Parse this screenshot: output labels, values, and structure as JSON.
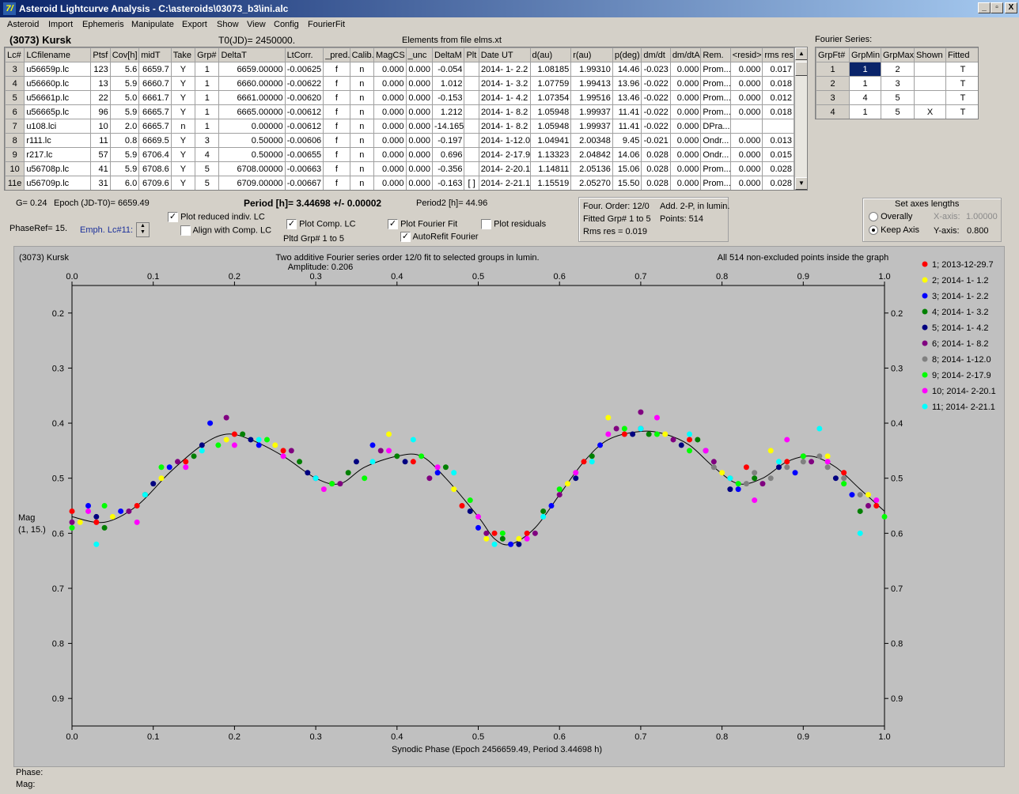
{
  "window": {
    "title": "Asteroid Lightcurve Analysis - C:\\asteroids\\03073_b3\\ini.alc",
    "icon": "7/",
    "controls": [
      "_",
      "▫",
      "X"
    ]
  },
  "menu": [
    "Asteroid",
    "Import",
    "Ephemeris",
    "Manipulate",
    "Export",
    "Show",
    "View",
    "Config",
    "FourierFit"
  ],
  "header": {
    "asteroid": "(3073) Kursk",
    "t0": "T0(JD)= 2450000.",
    "elements": "Elements from file elms.xt",
    "fourier_series": "Fourier Series:"
  },
  "lc_table": {
    "headers": [
      "Lc#",
      "LCfilename",
      "Ptsf",
      "Cov[h]",
      "midT",
      "Take",
      "Grp#",
      "DeltaT",
      "LtCorr.",
      "_pred.",
      "Calib.",
      "MagCS",
      "_unc",
      "DeltaM",
      "Plt",
      "Date UT",
      "d(au)",
      "r(au)",
      "p(deg)",
      "dm/dt",
      "dm/dtA",
      "Rem.",
      "<resid>",
      "rms res"
    ],
    "rows": [
      [
        "3",
        "u56659p.lc",
        "123",
        "5.6",
        "6659.7",
        "Y",
        "1",
        "6659.00000",
        "-0.00625",
        "f",
        "n",
        "0.000",
        "0.000",
        "-0.054",
        "",
        "2014- 1- 2.2",
        "1.08185",
        "1.99310",
        "14.46",
        "-0.023",
        "0.000",
        "Prom...",
        "0.000",
        "0.017"
      ],
      [
        "4",
        "u56660p.lc",
        "13",
        "5.9",
        "6660.7",
        "Y",
        "1",
        "6660.00000",
        "-0.00622",
        "f",
        "n",
        "0.000",
        "0.000",
        "1.012",
        "",
        "2014- 1- 3.2",
        "1.07759",
        "1.99413",
        "13.96",
        "-0.022",
        "0.000",
        "Prom...",
        "0.000",
        "0.018"
      ],
      [
        "5",
        "u56661p.lc",
        "22",
        "5.0",
        "6661.7",
        "Y",
        "1",
        "6661.00000",
        "-0.00620",
        "f",
        "n",
        "0.000",
        "0.000",
        "-0.153",
        "",
        "2014- 1- 4.2",
        "1.07354",
        "1.99516",
        "13.46",
        "-0.022",
        "0.000",
        "Prom...",
        "0.000",
        "0.012"
      ],
      [
        "6",
        "u56665p.lc",
        "96",
        "5.9",
        "6665.7",
        "Y",
        "1",
        "6665.00000",
        "-0.00612",
        "f",
        "n",
        "0.000",
        "0.000",
        "1.212",
        "",
        "2014- 1- 8.2",
        "1.05948",
        "1.99937",
        "11.41",
        "-0.022",
        "0.000",
        "Prom...",
        "0.000",
        "0.018"
      ],
      [
        "7",
        "u108.lci",
        "10",
        "2.0",
        "6665.7",
        "n",
        "1",
        "0.00000",
        "-0.00612",
        "f",
        "n",
        "0.000",
        "0.000",
        "-14.165",
        "",
        "2014- 1- 8.2",
        "1.05948",
        "1.99937",
        "11.41",
        "-0.022",
        "0.000",
        "DPra...",
        "",
        ""
      ],
      [
        "8",
        "r111.lc",
        "11",
        "0.8",
        "6669.5",
        "Y",
        "3",
        "0.50000",
        "-0.00606",
        "f",
        "n",
        "0.000",
        "0.000",
        "-0.197",
        "",
        "2014- 1-12.0",
        "1.04941",
        "2.00348",
        "9.45",
        "-0.021",
        "0.000",
        "Ondr...",
        "0.000",
        "0.013"
      ],
      [
        "9",
        "r217.lc",
        "57",
        "5.9",
        "6706.4",
        "Y",
        "4",
        "0.50000",
        "-0.00655",
        "f",
        "n",
        "0.000",
        "0.000",
        "0.696",
        "",
        "2014- 2-17.9",
        "1.13323",
        "2.04842",
        "14.06",
        "0.028",
        "0.000",
        "Ondr...",
        "0.000",
        "0.015"
      ],
      [
        "10",
        "u56708p.lc",
        "41",
        "5.9",
        "6708.6",
        "Y",
        "5",
        "6708.00000",
        "-0.00663",
        "f",
        "n",
        "0.000",
        "0.000",
        "-0.356",
        "",
        "2014- 2-20.1",
        "1.14811",
        "2.05136",
        "15.06",
        "0.028",
        "0.000",
        "Prom...",
        "0.000",
        "0.028"
      ],
      [
        "11e",
        "u56709p.lc",
        "31",
        "6.0",
        "6709.6",
        "Y",
        "5",
        "6709.00000",
        "-0.00667",
        "f",
        "n",
        "0.000",
        "0.000",
        "-0.163",
        "[ ]",
        "2014- 2-21.1",
        "1.15519",
        "2.05270",
        "15.50",
        "0.028",
        "0.000",
        "Prom...",
        "0.000",
        "0.028"
      ]
    ]
  },
  "fourier_table": {
    "headers": [
      "GrpFt#",
      "GrpMin",
      "GrpMax",
      "Shown",
      "Fitted"
    ],
    "rows": [
      [
        "1",
        "1",
        "2",
        "",
        "T"
      ],
      [
        "2",
        "1",
        "3",
        "",
        "T"
      ],
      [
        "3",
        "4",
        "5",
        "",
        "T"
      ],
      [
        "4",
        "1",
        "5",
        "X",
        "T"
      ]
    ]
  },
  "info": {
    "g": "G= 0.24",
    "epoch": "Epoch (JD-T0)= 6659.49",
    "period": "Period [h]= 3.44698 +/- 0.00002",
    "period2": "Period2 [h]= 44.96",
    "phase_ref": "PhaseRef= 15.",
    "emph": "Emph. Lc#11:",
    "plot_reduced": "Plot reduced indiv. LC",
    "align": "Align with Comp. LC",
    "plot_comp": "Plot Comp. LC",
    "pltd_grp": "Pltd Grp#  1   to    5",
    "plot_fourier": "Plot Fourier Fit",
    "autorefit": "AutoRefit Fourier",
    "plot_residuals": "Plot residuals",
    "fourier_info": [
      "Four. Order: 12/0",
      "Add. 2-P, in lumin.",
      "Fitted Grp# 1 to 5",
      "Points: 514",
      "Rms res     = 0.019"
    ],
    "axes_title": "Set axes lengths",
    "overally": "Overally",
    "keep_axis": "Keep Axis",
    "xaxis_label": "X-axis:",
    "xaxis_val": "1.00000",
    "yaxis_label": "Y-axis:",
    "yaxis_val": "0.800"
  },
  "checks": {
    "plot_reduced": true,
    "align": false,
    "plot_comp": true,
    "plot_fourier": true,
    "autorefit": true,
    "plot_residuals": false,
    "keep_axis": true
  },
  "plot": {
    "name": "(3073) Kursk",
    "caption1": "Two additive Fourier series order 12/0 fit to selected groups in lumin.",
    "caption2": "Amplitude: 0.206",
    "caption3": "All 514 non-excluded points inside the graph",
    "ylabel1": "Mag",
    "ylabel2": "(1, 15.)",
    "xlabel": "Synodic Phase (Epoch 2456659.49, Period 3.44698 h)"
  },
  "chart_data": {
    "type": "scatter",
    "xlim": [
      0.0,
      1.0
    ],
    "ylim": [
      0.15,
      0.95
    ],
    "y_inverted": true,
    "xticks": [
      "0.0",
      "0.1",
      "0.2",
      "0.3",
      "0.4",
      "0.5",
      "0.6",
      "0.7",
      "0.8",
      "0.9",
      "1.0"
    ],
    "yticks": [
      "0.2",
      "0.3",
      "0.4",
      "0.5",
      "0.6",
      "0.7",
      "0.8",
      "0.9"
    ],
    "fit_curve": {
      "x": [
        0.0,
        0.04,
        0.08,
        0.12,
        0.16,
        0.19,
        0.22,
        0.26,
        0.3,
        0.33,
        0.36,
        0.4,
        0.43,
        0.46,
        0.5,
        0.52,
        0.54,
        0.57,
        0.6,
        0.63,
        0.66,
        0.7,
        0.73,
        0.76,
        0.79,
        0.82,
        0.85,
        0.88,
        0.91,
        0.94,
        0.97,
        1.0
      ],
      "y": [
        0.57,
        0.58,
        0.55,
        0.49,
        0.44,
        0.42,
        0.43,
        0.46,
        0.5,
        0.51,
        0.48,
        0.46,
        0.46,
        0.5,
        0.57,
        0.61,
        0.62,
        0.59,
        0.53,
        0.47,
        0.43,
        0.415,
        0.42,
        0.44,
        0.48,
        0.51,
        0.5,
        0.47,
        0.46,
        0.48,
        0.52,
        0.56
      ]
    },
    "series": [
      {
        "name": "1; 2013-12-29.7",
        "color": "#ff0000",
        "points": [
          [
            0.0,
            0.56
          ],
          [
            0.03,
            0.58
          ],
          [
            0.08,
            0.55
          ],
          [
            0.14,
            0.47
          ],
          [
            0.2,
            0.42
          ],
          [
            0.26,
            0.45
          ],
          [
            0.32,
            0.51
          ],
          [
            0.42,
            0.47
          ],
          [
            0.48,
            0.55
          ],
          [
            0.52,
            0.6
          ],
          [
            0.56,
            0.6
          ],
          [
            0.63,
            0.47
          ],
          [
            0.68,
            0.42
          ],
          [
            0.76,
            0.43
          ],
          [
            0.83,
            0.48
          ],
          [
            0.88,
            0.47
          ],
          [
            0.95,
            0.49
          ],
          [
            0.99,
            0.55
          ]
        ]
      },
      {
        "name": "2; 2014- 1- 1.2",
        "color": "#ffff00",
        "points": [
          [
            0.01,
            0.58
          ],
          [
            0.05,
            0.57
          ],
          [
            0.11,
            0.5
          ],
          [
            0.19,
            0.43
          ],
          [
            0.25,
            0.44
          ],
          [
            0.31,
            0.52
          ],
          [
            0.39,
            0.42
          ],
          [
            0.47,
            0.52
          ],
          [
            0.51,
            0.61
          ],
          [
            0.55,
            0.61
          ],
          [
            0.61,
            0.51
          ],
          [
            0.66,
            0.39
          ],
          [
            0.73,
            0.42
          ],
          [
            0.8,
            0.49
          ],
          [
            0.86,
            0.45
          ],
          [
            0.93,
            0.46
          ],
          [
            0.98,
            0.53
          ]
        ]
      },
      {
        "name": "3; 2014- 1- 2.2",
        "color": "#0000ff",
        "points": [
          [
            0.02,
            0.55
          ],
          [
            0.06,
            0.56
          ],
          [
            0.12,
            0.48
          ],
          [
            0.17,
            0.4
          ],
          [
            0.23,
            0.44
          ],
          [
            0.3,
            0.5
          ],
          [
            0.37,
            0.44
          ],
          [
            0.45,
            0.49
          ],
          [
            0.5,
            0.59
          ],
          [
            0.54,
            0.62
          ],
          [
            0.59,
            0.55
          ],
          [
            0.65,
            0.44
          ],
          [
            0.7,
            0.41
          ],
          [
            0.78,
            0.45
          ],
          [
            0.82,
            0.52
          ],
          [
            0.89,
            0.49
          ],
          [
            0.96,
            0.53
          ]
        ]
      },
      {
        "name": "4; 2014- 1- 3.2",
        "color": "#008000",
        "points": [
          [
            0.04,
            0.59
          ],
          [
            0.09,
            0.53
          ],
          [
            0.15,
            0.46
          ],
          [
            0.21,
            0.42
          ],
          [
            0.28,
            0.47
          ],
          [
            0.34,
            0.49
          ],
          [
            0.4,
            0.46
          ],
          [
            0.46,
            0.48
          ],
          [
            0.53,
            0.61
          ],
          [
            0.58,
            0.56
          ],
          [
            0.64,
            0.46
          ],
          [
            0.71,
            0.42
          ],
          [
            0.77,
            0.43
          ],
          [
            0.84,
            0.5
          ],
          [
            0.9,
            0.46
          ],
          [
            0.97,
            0.56
          ]
        ]
      },
      {
        "name": "5; 2014- 1- 4.2",
        "color": "#000080",
        "points": [
          [
            0.03,
            0.57
          ],
          [
            0.1,
            0.51
          ],
          [
            0.16,
            0.44
          ],
          [
            0.22,
            0.43
          ],
          [
            0.29,
            0.49
          ],
          [
            0.35,
            0.47
          ],
          [
            0.41,
            0.47
          ],
          [
            0.49,
            0.56
          ],
          [
            0.55,
            0.62
          ],
          [
            0.62,
            0.5
          ],
          [
            0.69,
            0.42
          ],
          [
            0.75,
            0.44
          ],
          [
            0.81,
            0.52
          ],
          [
            0.87,
            0.48
          ],
          [
            0.94,
            0.5
          ]
        ]
      },
      {
        "name": "6; 2014- 1- 8.2",
        "color": "#800080",
        "points": [
          [
            0.0,
            0.58
          ],
          [
            0.07,
            0.56
          ],
          [
            0.13,
            0.47
          ],
          [
            0.19,
            0.39
          ],
          [
            0.27,
            0.45
          ],
          [
            0.33,
            0.51
          ],
          [
            0.38,
            0.45
          ],
          [
            0.44,
            0.5
          ],
          [
            0.51,
            0.6
          ],
          [
            0.57,
            0.6
          ],
          [
            0.6,
            0.53
          ],
          [
            0.67,
            0.41
          ],
          [
            0.7,
            0.38
          ],
          [
            0.74,
            0.43
          ],
          [
            0.79,
            0.47
          ],
          [
            0.85,
            0.51
          ],
          [
            0.91,
            0.47
          ],
          [
            0.98,
            0.55
          ]
        ]
      },
      {
        "name": "8; 2014- 1-12.0",
        "color": "#808080",
        "points": [
          [
            0.79,
            0.48
          ],
          [
            0.81,
            0.5
          ],
          [
            0.83,
            0.51
          ],
          [
            0.84,
            0.49
          ],
          [
            0.86,
            0.5
          ],
          [
            0.88,
            0.48
          ],
          [
            0.9,
            0.47
          ],
          [
            0.92,
            0.46
          ],
          [
            0.93,
            0.48
          ],
          [
            0.95,
            0.5
          ],
          [
            0.97,
            0.53
          ]
        ]
      },
      {
        "name": "9; 2014- 2-17.9",
        "color": "#00ff00",
        "points": [
          [
            0.0,
            0.59
          ],
          [
            0.04,
            0.55
          ],
          [
            0.11,
            0.48
          ],
          [
            0.18,
            0.44
          ],
          [
            0.24,
            0.43
          ],
          [
            0.32,
            0.51
          ],
          [
            0.36,
            0.5
          ],
          [
            0.43,
            0.46
          ],
          [
            0.49,
            0.54
          ],
          [
            0.53,
            0.6
          ],
          [
            0.6,
            0.52
          ],
          [
            0.68,
            0.41
          ],
          [
            0.72,
            0.42
          ],
          [
            0.76,
            0.45
          ],
          [
            0.82,
            0.51
          ],
          [
            0.9,
            0.46
          ],
          [
            0.95,
            0.51
          ],
          [
            1.0,
            0.57
          ]
        ]
      },
      {
        "name": "10; 2014- 2-20.1",
        "color": "#ff00ff",
        "points": [
          [
            0.02,
            0.56
          ],
          [
            0.08,
            0.58
          ],
          [
            0.14,
            0.48
          ],
          [
            0.2,
            0.44
          ],
          [
            0.26,
            0.46
          ],
          [
            0.31,
            0.52
          ],
          [
            0.39,
            0.45
          ],
          [
            0.45,
            0.48
          ],
          [
            0.5,
            0.57
          ],
          [
            0.56,
            0.61
          ],
          [
            0.62,
            0.49
          ],
          [
            0.66,
            0.42
          ],
          [
            0.72,
            0.39
          ],
          [
            0.78,
            0.45
          ],
          [
            0.84,
            0.54
          ],
          [
            0.88,
            0.43
          ],
          [
            0.93,
            0.47
          ],
          [
            0.99,
            0.54
          ]
        ]
      },
      {
        "name": "11; 2014- 2-21.1",
        "color": "#00ffff",
        "points": [
          [
            0.03,
            0.62
          ],
          [
            0.09,
            0.53
          ],
          [
            0.16,
            0.45
          ],
          [
            0.23,
            0.43
          ],
          [
            0.3,
            0.5
          ],
          [
            0.37,
            0.47
          ],
          [
            0.42,
            0.43
          ],
          [
            0.47,
            0.49
          ],
          [
            0.52,
            0.62
          ],
          [
            0.58,
            0.57
          ],
          [
            0.64,
            0.47
          ],
          [
            0.7,
            0.41
          ],
          [
            0.76,
            0.42
          ],
          [
            0.81,
            0.5
          ],
          [
            0.87,
            0.47
          ],
          [
            0.92,
            0.41
          ],
          [
            0.97,
            0.6
          ]
        ]
      }
    ]
  }
}
